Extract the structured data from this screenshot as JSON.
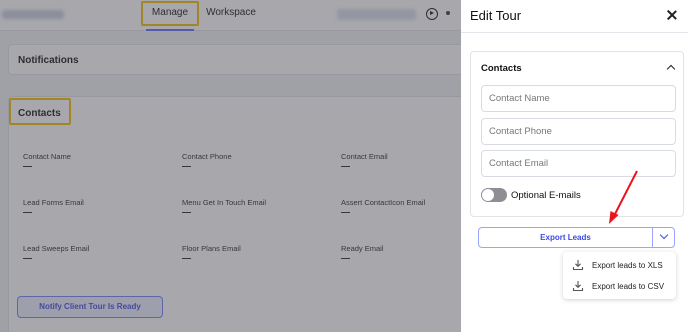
{
  "topbar": {
    "tabs": [
      {
        "label": "Manage",
        "active": true
      },
      {
        "label": "Workspace",
        "active": false
      }
    ]
  },
  "notifications": {
    "title": "Notifications"
  },
  "contacts_section": {
    "title": "Contacts",
    "fields": [
      {
        "label": "Contact Name",
        "value": "—"
      },
      {
        "label": "Contact Phone",
        "value": "—"
      },
      {
        "label": "Contact Email",
        "value": "—"
      },
      {
        "label": "Lead Forms Email",
        "value": "—"
      },
      {
        "label": "Menu Get In Touch Email",
        "value": "—"
      },
      {
        "label": "Assert ContactIcon Email",
        "value": "—"
      },
      {
        "label": "Lead Sweeps Email",
        "value": "—"
      },
      {
        "label": "Floor Plans Email",
        "value": "—"
      },
      {
        "label": "Ready Email",
        "value": "—"
      }
    ],
    "notify_button": "Notify Client Tour Is Ready"
  },
  "panel": {
    "title": "Edit Tour",
    "contacts": {
      "title": "Contacts",
      "inputs": [
        {
          "placeholder": "Contact Name",
          "value": ""
        },
        {
          "placeholder": "Contact Phone",
          "value": ""
        },
        {
          "placeholder": "Contact Email",
          "value": ""
        }
      ],
      "optional_emails": {
        "label": "Optional E-mails",
        "on": false
      }
    },
    "export": {
      "label": "Export Leads",
      "menu": [
        {
          "label": "Export leads to XLS"
        },
        {
          "label": "Export leads to CSV"
        }
      ]
    }
  },
  "colors": {
    "accent": "#3d49e3",
    "highlight": "#f4c20d",
    "annotation_arrow": "#e8151b"
  }
}
